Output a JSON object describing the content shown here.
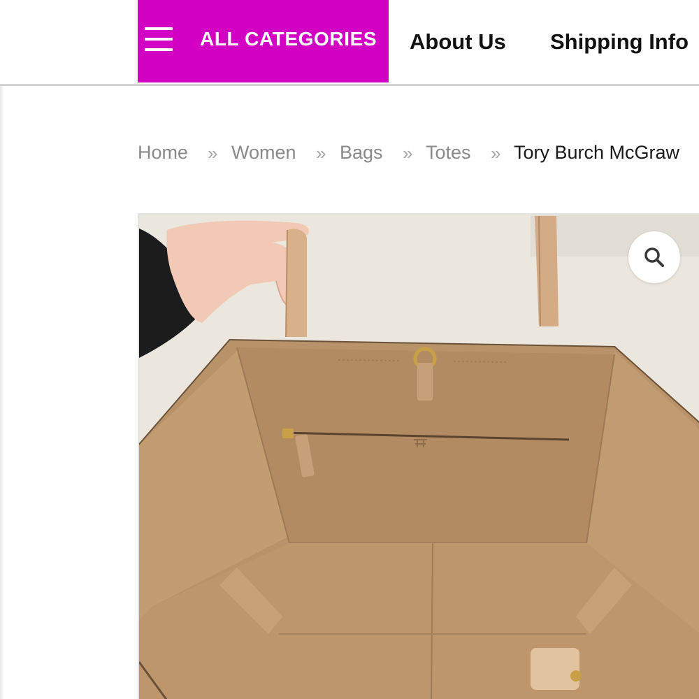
{
  "header": {
    "categories_label": "ALL CATEGORIES",
    "nav_links": [
      "About Us",
      "Shipping Info"
    ]
  },
  "breadcrumb": {
    "items": [
      "Home",
      "Women",
      "Bags",
      "Totes"
    ],
    "current": "Tory Burch McGraw",
    "separator": "»"
  },
  "product_image": {
    "subject": "tan leather tote bag interior held by strap",
    "zoom_icon": "search-icon"
  },
  "colors": {
    "accent": "#d100c3",
    "breadcrumb_link": "#8a8a8a",
    "text_dark": "#111111"
  }
}
